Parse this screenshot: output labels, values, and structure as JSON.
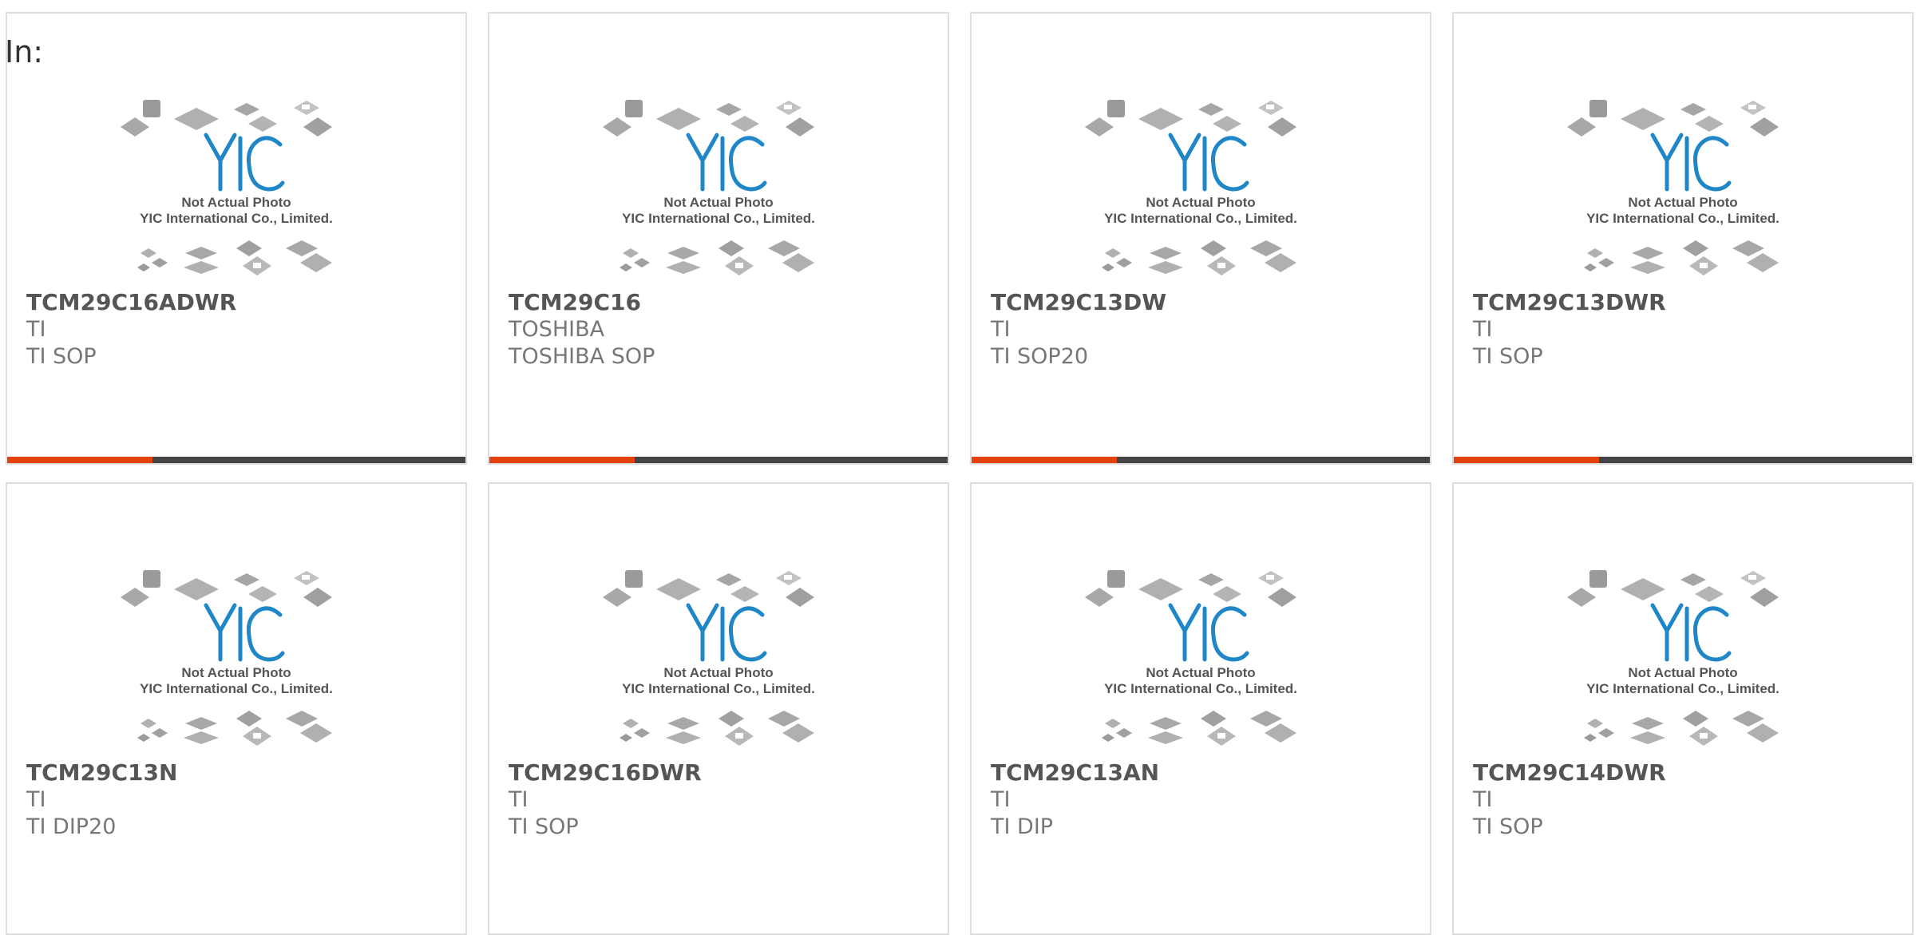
{
  "filter_label": "In:",
  "placeholder": {
    "line1": "Not Actual Photo",
    "line2": "YIC International Co., Limited."
  },
  "colors": {
    "accent": "#e5400f",
    "bar": "#444444",
    "logo": "#1f86c8"
  },
  "products": [
    {
      "part_number": "TCM29C16ADWR",
      "manufacturer": "TI",
      "package": "TI SOP"
    },
    {
      "part_number": "TCM29C16",
      "manufacturer": "TOSHIBA",
      "package": "TOSHIBA SOP"
    },
    {
      "part_number": "TCM29C13DW",
      "manufacturer": "TI",
      "package": "TI SOP20"
    },
    {
      "part_number": "TCM29C13DWR",
      "manufacturer": "TI",
      "package": "TI SOP"
    },
    {
      "part_number": "TCM29C13N",
      "manufacturer": "TI",
      "package": "TI DIP20"
    },
    {
      "part_number": "TCM29C16DWR",
      "manufacturer": "TI",
      "package": "TI SOP"
    },
    {
      "part_number": "TCM29C13AN",
      "manufacturer": "TI",
      "package": "TI DIP"
    },
    {
      "part_number": "TCM29C14DWR",
      "manufacturer": "TI",
      "package": "TI SOP"
    }
  ]
}
